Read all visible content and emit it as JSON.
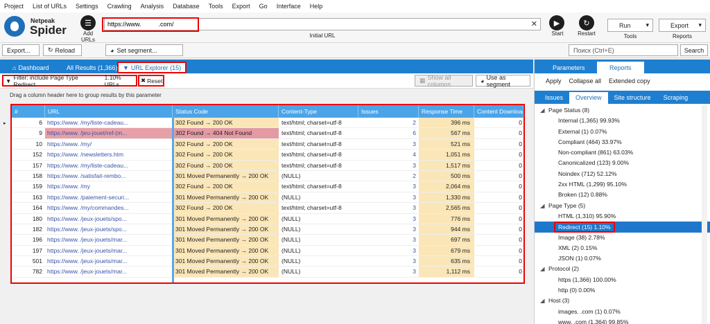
{
  "menu": [
    "Project",
    "List of URLs",
    "Settings",
    "Crawling",
    "Analysis",
    "Database",
    "Tools",
    "Export",
    "Go",
    "Interface",
    "Help"
  ],
  "logo": {
    "line1": "Netpeak",
    "line2": "Spider"
  },
  "toolbar": {
    "add_urls": "Add URLs",
    "url_value": "https://www.          .com/",
    "initial_url_label": "Initial URL",
    "start": "Start",
    "restart": "Restart",
    "run": "Run",
    "tools": "Tools",
    "export": "Export",
    "reports": "Reports"
  },
  "bar2": {
    "export_btn": "Export...",
    "reload_btn": "Reload",
    "set_segment": "Set segment...",
    "search_placeholder": "Поиск (Ctrl+E)",
    "search_btn": "Search"
  },
  "tabs": {
    "dashboard": "Dashboard",
    "all_results": "All Results (1,366)",
    "url_explorer": "URL Explorer (15)"
  },
  "filter": {
    "label": "Filter: include Page Type Redirect",
    "count": "1.10% URLs",
    "reset": "Reset",
    "show_all": "Show all columns",
    "use_segment": "Use as segment"
  },
  "hint": "Drag a column header here to group results by this parameter",
  "table": {
    "columns": [
      "#",
      "URL",
      "Status Code",
      "Content-Type",
      "Issues",
      "Response Time",
      "Content Download"
    ],
    "rows": [
      {
        "num": "6",
        "url": "https://www.          /my/liste-cadeau...",
        "status": "302 Found → 200 OK",
        "ctype": "text/html; charset=utf-8",
        "issues": "2",
        "rtime": "396 ms",
        "cd": "0",
        "red": false
      },
      {
        "num": "9",
        "url": "https://www.          /jeu-jouet/ref-(m...",
        "status": "302 Found → 404 Not Found",
        "ctype": "text/html; charset=utf-8",
        "issues": "6",
        "rtime": "567 ms",
        "cd": "0",
        "red": true
      },
      {
        "num": "10",
        "url": "https://www.          /my/",
        "status": "302 Found → 200 OK",
        "ctype": "text/html; charset=utf-8",
        "issues": "3",
        "rtime": "521 ms",
        "cd": "0",
        "red": false
      },
      {
        "num": "152",
        "url": "https://www.          /newsletters.htm",
        "status": "302 Found → 200 OK",
        "ctype": "text/html; charset=utf-8",
        "issues": "4",
        "rtime": "1,051 ms",
        "cd": "0",
        "red": false
      },
      {
        "num": "157",
        "url": "https://www.          /my/liste-cadeau...",
        "status": "302 Found → 200 OK",
        "ctype": "text/html; charset=utf-8",
        "issues": "3",
        "rtime": "1,517 ms",
        "cd": "0",
        "red": false
      },
      {
        "num": "158",
        "url": "https://www.          /satisfait-rembo...",
        "status": "301 Moved Permanently → 200 OK",
        "ctype": "(NULL)",
        "issues": "2",
        "rtime": "500 ms",
        "cd": "0",
        "red": false
      },
      {
        "num": "159",
        "url": "https://www.          /my",
        "status": "302 Found → 200 OK",
        "ctype": "text/html; charset=utf-8",
        "issues": "3",
        "rtime": "2,064 ms",
        "cd": "0",
        "red": false
      },
      {
        "num": "163",
        "url": "https://www.          /paiement-securi...",
        "status": "301 Moved Permanently → 200 OK",
        "ctype": "(NULL)",
        "issues": "3",
        "rtime": "1,330 ms",
        "cd": "0",
        "red": false
      },
      {
        "num": "164",
        "url": "https://www.          /my/commandes...",
        "status": "302 Found → 200 OK",
        "ctype": "text/html; charset=utf-8",
        "issues": "3",
        "rtime": "2,565 ms",
        "cd": "0",
        "red": false
      },
      {
        "num": "180",
        "url": "https://www.          /jeux-jouets/spo...",
        "status": "301 Moved Permanently → 200 OK",
        "ctype": "(NULL)",
        "issues": "3",
        "rtime": "776 ms",
        "cd": "0",
        "red": false
      },
      {
        "num": "182",
        "url": "https://www.          /jeux-jouets/spo...",
        "status": "301 Moved Permanently → 200 OK",
        "ctype": "(NULL)",
        "issues": "3",
        "rtime": "944 ms",
        "cd": "0",
        "red": false
      },
      {
        "num": "196",
        "url": "https://www.          /jeux-jouets/mar...",
        "status": "301 Moved Permanently → 200 OK",
        "ctype": "(NULL)",
        "issues": "3",
        "rtime": "697 ms",
        "cd": "0",
        "red": false
      },
      {
        "num": "197",
        "url": "https://www.          /jeux-jouets/mar...",
        "status": "301 Moved Permanently → 200 OK",
        "ctype": "(NULL)",
        "issues": "3",
        "rtime": "679 ms",
        "cd": "0",
        "red": false
      },
      {
        "num": "501",
        "url": "https://www.          /jeux-jouets/mar...",
        "status": "301 Moved Permanently → 200 OK",
        "ctype": "(NULL)",
        "issues": "3",
        "rtime": "635 ms",
        "cd": "0",
        "red": false
      },
      {
        "num": "782",
        "url": "https://www.          /jeux-jouets/mar...",
        "status": "301 Moved Permanently → 200 OK",
        "ctype": "(NULL)",
        "issues": "3",
        "rtime": "1,112 ms",
        "cd": "0",
        "red": false
      }
    ]
  },
  "right": {
    "tab_parameters": "Parameters",
    "tab_reports": "Reports",
    "apply": "Apply",
    "collapse_all": "Collapse all",
    "extended_copy": "Extended copy",
    "subtabs": [
      "Issues",
      "Overview",
      "Site structure",
      "Scraping"
    ],
    "tree": [
      {
        "kind": "grp",
        "text": "Page Status (8)"
      },
      {
        "kind": "item",
        "text": "Internal (1,365) 99.93%"
      },
      {
        "kind": "item",
        "text": "External (1) 0.07%"
      },
      {
        "kind": "item",
        "text": "Compliant (464) 33.97%"
      },
      {
        "kind": "item",
        "text": "Non-compliant (861) 63.03%"
      },
      {
        "kind": "item",
        "text": "Canonicalized (123) 9.00%"
      },
      {
        "kind": "item",
        "text": "Noindex (712) 52.12%"
      },
      {
        "kind": "item",
        "text": "2xx HTML (1,299) 95.10%"
      },
      {
        "kind": "item",
        "text": "Broken (12) 0.88%"
      },
      {
        "kind": "grp",
        "text": "Page Type (5)"
      },
      {
        "kind": "item",
        "text": "HTML (1,310) 95.90%"
      },
      {
        "kind": "sel",
        "text": "Redirect (15) 1.10%"
      },
      {
        "kind": "item",
        "text": "Image (38) 2.78%"
      },
      {
        "kind": "item",
        "text": "XML (2) 0.15%"
      },
      {
        "kind": "item",
        "text": "JSON (1) 0.07%"
      },
      {
        "kind": "grp",
        "text": "Protocol (2)"
      },
      {
        "kind": "item",
        "text": "https (1,366) 100.00%"
      },
      {
        "kind": "item",
        "text": "http (0) 0.00%"
      },
      {
        "kind": "grp",
        "text": "Host (3)"
      },
      {
        "kind": "item",
        "text": "images.          .com (1) 0.07%"
      },
      {
        "kind": "item",
        "text": "www.          .com (1,364) 99.85%"
      }
    ]
  }
}
